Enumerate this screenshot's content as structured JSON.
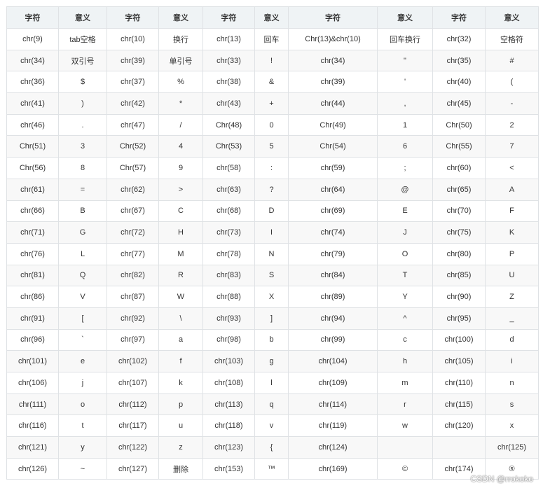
{
  "table": {
    "headers": [
      "字符",
      "意义",
      "字符",
      "意义",
      "字符",
      "意义",
      "字符",
      "意义",
      "字符",
      "意义"
    ],
    "rows": [
      [
        "chr(9)",
        "tab空格",
        "chr(10)",
        "换行",
        "chr(13)",
        "回车",
        "Chr(13)&chr(10)",
        "回车换行",
        "chr(32)",
        "空格符"
      ],
      [
        "chr(34)",
        "双引号",
        "chr(39)",
        "单引号",
        "chr(33)",
        "!",
        "chr(34)",
        "\"",
        "chr(35)",
        "#"
      ],
      [
        "chr(36)",
        "$",
        "chr(37)",
        "%",
        "chr(38)",
        "&",
        "chr(39)",
        "'",
        "chr(40)",
        "("
      ],
      [
        "chr(41)",
        ")",
        "chr(42)",
        "*",
        "chr(43)",
        "+",
        "chr(44)",
        ",",
        "chr(45)",
        "-"
      ],
      [
        "chr(46)",
        ".",
        "chr(47)",
        "/",
        "Chr(48)",
        "0",
        "Chr(49)",
        "1",
        "Chr(50)",
        "2"
      ],
      [
        "Chr(51)",
        "3",
        "Chr(52)",
        "4",
        "Chr(53)",
        "5",
        "Chr(54)",
        "6",
        "Chr(55)",
        "7"
      ],
      [
        "Chr(56)",
        "8",
        "Chr(57)",
        "9",
        "chr(58)",
        ":",
        "chr(59)",
        ";",
        "chr(60)",
        "<"
      ],
      [
        "chr(61)",
        "=",
        "chr(62)",
        ">",
        "chr(63)",
        "?",
        "chr(64)",
        "@",
        "chr(65)",
        "A"
      ],
      [
        "chr(66)",
        "B",
        "chr(67)",
        "C",
        "chr(68)",
        "D",
        "chr(69)",
        "E",
        "chr(70)",
        "F"
      ],
      [
        "chr(71)",
        "G",
        "chr(72)",
        "H",
        "chr(73)",
        "I",
        "chr(74)",
        "J",
        "chr(75)",
        "K"
      ],
      [
        "chr(76)",
        "L",
        "chr(77)",
        "M",
        "chr(78)",
        "N",
        "chr(79)",
        "O",
        "chr(80)",
        "P"
      ],
      [
        "chr(81)",
        "Q",
        "chr(82)",
        "R",
        "chr(83)",
        "S",
        "chr(84)",
        "T",
        "chr(85)",
        "U"
      ],
      [
        "chr(86)",
        "V",
        "chr(87)",
        "W",
        "chr(88)",
        "X",
        "chr(89)",
        "Y",
        "chr(90)",
        "Z"
      ],
      [
        "chr(91)",
        "[",
        "chr(92)",
        "\\",
        "chr(93)",
        "]",
        "chr(94)",
        "^",
        "chr(95)",
        "_"
      ],
      [
        "chr(96)",
        "`",
        "chr(97)",
        "a",
        "chr(98)",
        "b",
        "chr(99)",
        "c",
        "chr(100)",
        "d"
      ],
      [
        "chr(101)",
        "e",
        "chr(102)",
        "f",
        "chr(103)",
        "g",
        "chr(104)",
        "h",
        "chr(105)",
        "i"
      ],
      [
        "chr(106)",
        "j",
        "chr(107)",
        "k",
        "chr(108)",
        "l",
        "chr(109)",
        "m",
        "chr(110)",
        "n"
      ],
      [
        "chr(111)",
        "o",
        "chr(112)",
        "p",
        "chr(113)",
        "q",
        "chr(114)",
        "r",
        "chr(115)",
        "s"
      ],
      [
        "chr(116)",
        "t",
        "chr(117)",
        "u",
        "chr(118)",
        "v",
        "chr(119)",
        "w",
        "chr(120)",
        "x"
      ],
      [
        "chr(121)",
        "y",
        "chr(122)",
        "z",
        "chr(123)",
        "{",
        "chr(124)",
        "",
        "",
        "chr(125)"
      ],
      [
        "chr(126)",
        "~",
        "chr(127)",
        "删除",
        "chr(153)",
        "™",
        "chr(169)",
        "©",
        "chr(174)",
        "®"
      ]
    ]
  },
  "watermark": "CSDN @rrokoko"
}
